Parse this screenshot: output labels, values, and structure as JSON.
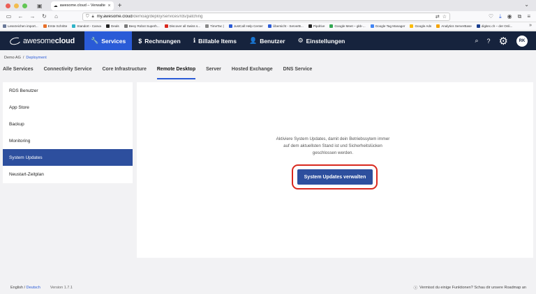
{
  "browser": {
    "tab_title": "awesome.cloud – Verwalte dein",
    "url_host": "my.awesome.cloud",
    "url_path": "/demoag/deploy/services/rds/patching",
    "bookmarks": [
      {
        "label": "Lesezeichen import...",
        "color": "#6b7a99"
      },
      {
        "label": "Erste Schritte",
        "color": "#e8702a"
      },
      {
        "label": "Standort - Canva",
        "color": "#2fb4c8"
      },
      {
        "label": "Deals",
        "color": "#222222"
      },
      {
        "label": "Beey Robot Superh...",
        "color": "#7a7a7a"
      },
      {
        "label": "Discover all Swiss s...",
        "color": "#d9281e"
      },
      {
        "label": "TimeTac |",
        "color": "#888888"
      },
      {
        "label": "JustCall Help Center",
        "color": "#2a5bd7"
      },
      {
        "label": "Übersicht - ServerB...",
        "color": "#2a5bd7"
      },
      {
        "label": "Pipdrive",
        "color": "#222222"
      },
      {
        "label": "Google Meet – gkb-...",
        "color": "#34a853"
      },
      {
        "label": "Google Tag Manager",
        "color": "#4285f4"
      },
      {
        "label": "Google Ads",
        "color": "#fbbc05"
      },
      {
        "label": "Analytics ServerBase",
        "color": "#f4a300"
      },
      {
        "label": "digitec.ch – der Onli...",
        "color": "#1a3f8f"
      }
    ]
  },
  "app": {
    "logo_light": "awesome",
    "logo_bold": "cloud",
    "nav": [
      {
        "label": "Services",
        "icon": "wrench-icon",
        "glyph": "🔧",
        "active": true
      },
      {
        "label": "Rechnungen",
        "icon": "dollar-icon",
        "glyph": "$",
        "active": false
      },
      {
        "label": "Billable Items",
        "icon": "info-icon",
        "glyph": "ℹ",
        "active": false
      },
      {
        "label": "Benutzer",
        "icon": "user-icon",
        "glyph": "👤",
        "active": false
      },
      {
        "label": "Einstellungen",
        "icon": "gear-icon",
        "glyph": "⚙",
        "active": false
      }
    ],
    "avatar_initials": "RK",
    "accent": "#2a5bd7",
    "nav_bg": "#16233d"
  },
  "breadcrumb": {
    "root": "Demo AG",
    "separator": "/",
    "current": "Deployment"
  },
  "subtabs": [
    {
      "label": "Alle Services",
      "active": false
    },
    {
      "label": "Connectivity Service",
      "active": false
    },
    {
      "label": "Core Infrastructure",
      "active": false
    },
    {
      "label": "Remote Desktop",
      "active": true
    },
    {
      "label": "Server",
      "active": false
    },
    {
      "label": "Hosted Exchange",
      "active": false
    },
    {
      "label": "DNS Service",
      "active": false
    }
  ],
  "sidebar": {
    "items": [
      {
        "label": "RDS Benutzer",
        "active": false
      },
      {
        "label": "App Store",
        "active": false
      },
      {
        "label": "Backup",
        "active": false
      },
      {
        "label": "Monitoring",
        "active": false
      },
      {
        "label": "System Updates",
        "active": true
      },
      {
        "label": "Neustart-Zeitplan",
        "active": false
      }
    ]
  },
  "main": {
    "message": "Aktiviere System Updates, damit dein Betriebssytem immer auf dem aktuellsten Stand ist und Sicherheitslücken geschlossen werden.",
    "button_label": "System Updates verwalten"
  },
  "footer": {
    "lang_en": "English",
    "lang_sep": " / ",
    "lang_de": "Deutsch",
    "version": "Version 1.7.1",
    "feedback": "Vermisst du einige Funktionen? Schau dir unsere Roadmap an"
  }
}
